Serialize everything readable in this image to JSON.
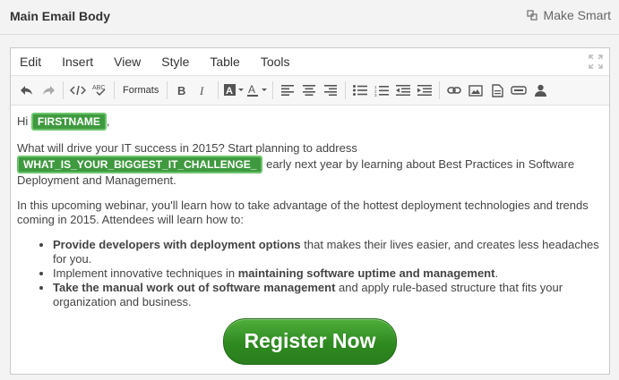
{
  "header": {
    "title": "Main Email Body",
    "make_smart_label": "Make Smart"
  },
  "menu": {
    "items": [
      {
        "label": "Edit"
      },
      {
        "label": "Insert"
      },
      {
        "label": "View"
      },
      {
        "label": "Style"
      },
      {
        "label": "Table"
      },
      {
        "label": "Tools"
      }
    ]
  },
  "toolbar": {
    "formats_label": "Formats",
    "icons": [
      "undo-icon",
      "redo-icon",
      "source-code-icon",
      "spellcheck-icon",
      "bold-icon",
      "italic-icon",
      "background-color-icon",
      "text-color-icon",
      "align-left-icon",
      "align-center-icon",
      "align-right-icon",
      "bullet-list-icon",
      "numbered-list-icon",
      "outdent-icon",
      "indent-icon",
      "link-icon",
      "image-icon",
      "document-icon",
      "form-field-icon",
      "person-icon"
    ]
  },
  "body": {
    "greeting": "Hi ",
    "firstname_tag": "FIRSTNAME",
    "greeting_end": ",",
    "p1_start": "What will drive your IT success in 2015? Start planning to address",
    "challenge_tag": "WHAT_IS_YOUR_BIGGEST_IT_CHALLENGE_",
    "p1_end": " early next year by learning about Best Practices in Software Deployment and Management.",
    "p2": "In this upcoming webinar, you'll learn how to take advantage of the hottest deployment technologies and trends coming in 2015. Attendees will learn how to:",
    "bullets": [
      {
        "bold": "Provide developers with deployment options",
        "text": " that makes their lives easier, and creates less headaches for you."
      },
      {
        "pre": "Implement innovative techniques in ",
        "bold": "maintaining software uptime and management",
        "post": "."
      },
      {
        "bold": "Take the manual work out of software management",
        "text": " and apply rule-based structure that fits your organization and business."
      }
    ],
    "cta_label": "Register Now"
  },
  "colors": {
    "tag_bg": "#3f9a3f",
    "cta_bg": "#2f8a21"
  }
}
